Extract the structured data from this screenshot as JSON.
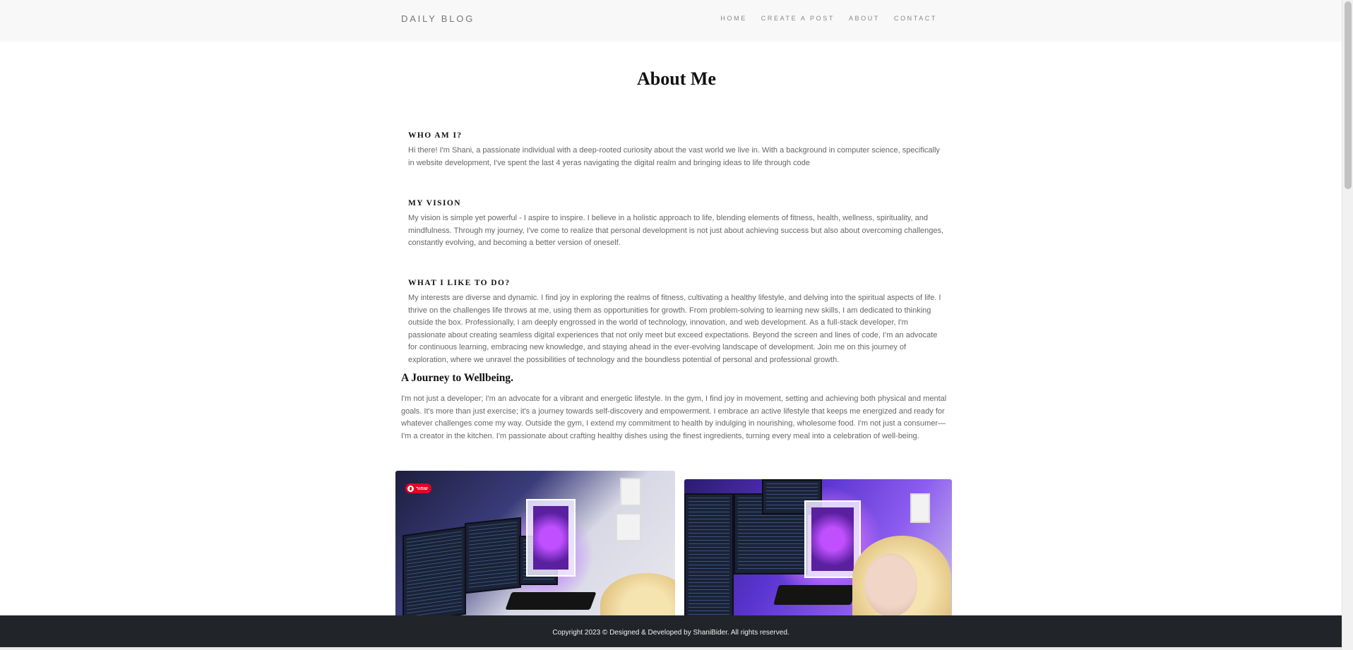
{
  "navbar": {
    "brand": "DAILY BLOG",
    "links": [
      "HOME",
      "CREATE A POST",
      "ABOUT",
      "CONTACT"
    ]
  },
  "page": {
    "title": "About Me"
  },
  "sections": [
    {
      "heading": "WHO AM I?",
      "text": "Hi there! I'm Shani, a passionate individual with a deep-rooted curiosity about the vast world we live in. With a background in computer science, specifically in website development, I've spent the last 4 yeras navigating the digital realm and bringing ideas to life through code"
    },
    {
      "heading": "MY VISION",
      "text": "My vision is simple yet powerful - I aspire to inspire. I believe in a holistic approach to life, blending elements of fitness, health, wellness, spirituality, and mindfulness. Through my journey, I've come to realize that personal development is not just about achieving success but also about overcoming challenges, constantly evolving, and becoming a better version of oneself."
    },
    {
      "heading": "WHAT I LIKE TO DO?",
      "text": "My interests are diverse and dynamic. I find joy in exploring the realms of fitness, cultivating a healthy lifestyle, and delving into the spiritual aspects of life. I thrive on the challenges life throws at me, using them as opportunities for growth. From problem-solving to learning new skills, I am dedicated to thinking outside the box. Professionally, I am deeply engrossed in the world of technology, innovation, and web development. As a full-stack developer, I'm passionate about creating seamless digital experiences that not only meet but exceed expectations. Beyond the screen and lines of code, I'm an advocate for continuous learning, embracing new knowledge, and staying ahead in the ever-evolving landscape of development. Join me on this journey of exploration, where we unravel the possibilities of technology and the boundless potential of personal and professional growth."
    }
  ],
  "journey": {
    "heading": "A Journey to Wellbeing.",
    "text": "I'm not just a developer; I'm an advocate for a vibrant and energetic lifestyle. In the gym, I find joy in movement, setting and achieving both physical and mental goals. It's more than just exercise; it's a journey towards self-discovery and empowerment. I embrace an active lifestyle that keeps me energized and ready for whatever challenges come my way. Outside the gym, I extend my commitment to health by indulging in nourishing, wholesome food. I'm not just a consumer—I'm a creator in the kitchen. I'm passionate about crafting healthy dishes using the finest ingredients, turning every meal into a celebration of well-being."
  },
  "photos": {
    "pin_label": "שמור"
  },
  "footer": {
    "text": "Copyright 2023 © Designed & Developed by ShaniBider. All rights reserved."
  },
  "colors": {
    "navbar_bg": "#f8f8f8",
    "footer_bg": "#212529",
    "pin_red": "#e60023"
  }
}
